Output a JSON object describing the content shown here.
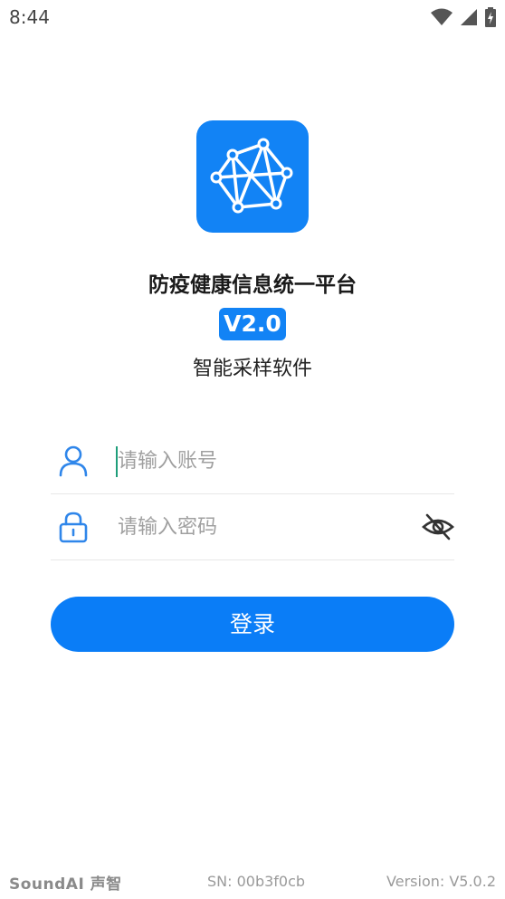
{
  "status_bar": {
    "time": "8:44",
    "icons": [
      "wifi-icon",
      "cell-signal-icon",
      "battery-charging-icon"
    ]
  },
  "app": {
    "icon": "network-logo-icon",
    "title": "防疫健康信息统一平台",
    "version_badge": "V2.0",
    "subtitle": "智能采样软件",
    "brand_color": "#1283f5"
  },
  "form": {
    "account": {
      "icon": "user-icon",
      "placeholder": "请输入账号",
      "value": ""
    },
    "password": {
      "icon": "lock-icon",
      "placeholder": "请输入密码",
      "value": "",
      "toggle_icon": "eye-hidden-icon"
    },
    "login_label": "登录"
  },
  "footer": {
    "logo_text": "SoundAI 声智",
    "sn": "SN: 00b3f0cb",
    "version": "Version: V5.0.2"
  }
}
